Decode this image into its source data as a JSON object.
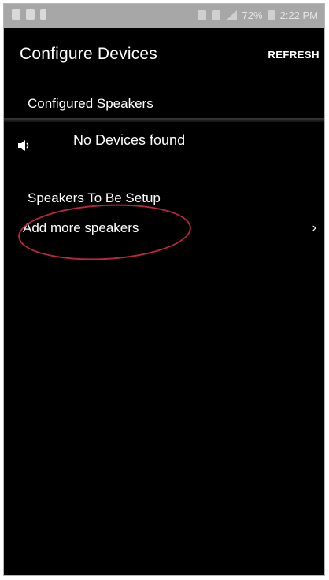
{
  "status_bar": {
    "battery_percent": "72%",
    "time": "2:22 PM"
  },
  "header": {
    "title": "Configure Devices",
    "refresh_label": "REFRESH"
  },
  "sections": {
    "configured": {
      "title": "Configured Speakers",
      "empty_message": "No Devices found",
      "empty_icon": "speaker-icon"
    },
    "to_setup": {
      "title": "Speakers To Be Setup",
      "items": [
        {
          "label": "Add more speakers",
          "icon": "chevron-right-icon",
          "chevron": "›"
        }
      ]
    }
  },
  "colors": {
    "background": "#000000",
    "text": "#ffffff",
    "status_bar": "#a7a7a7",
    "annotation": "#b8283b"
  }
}
